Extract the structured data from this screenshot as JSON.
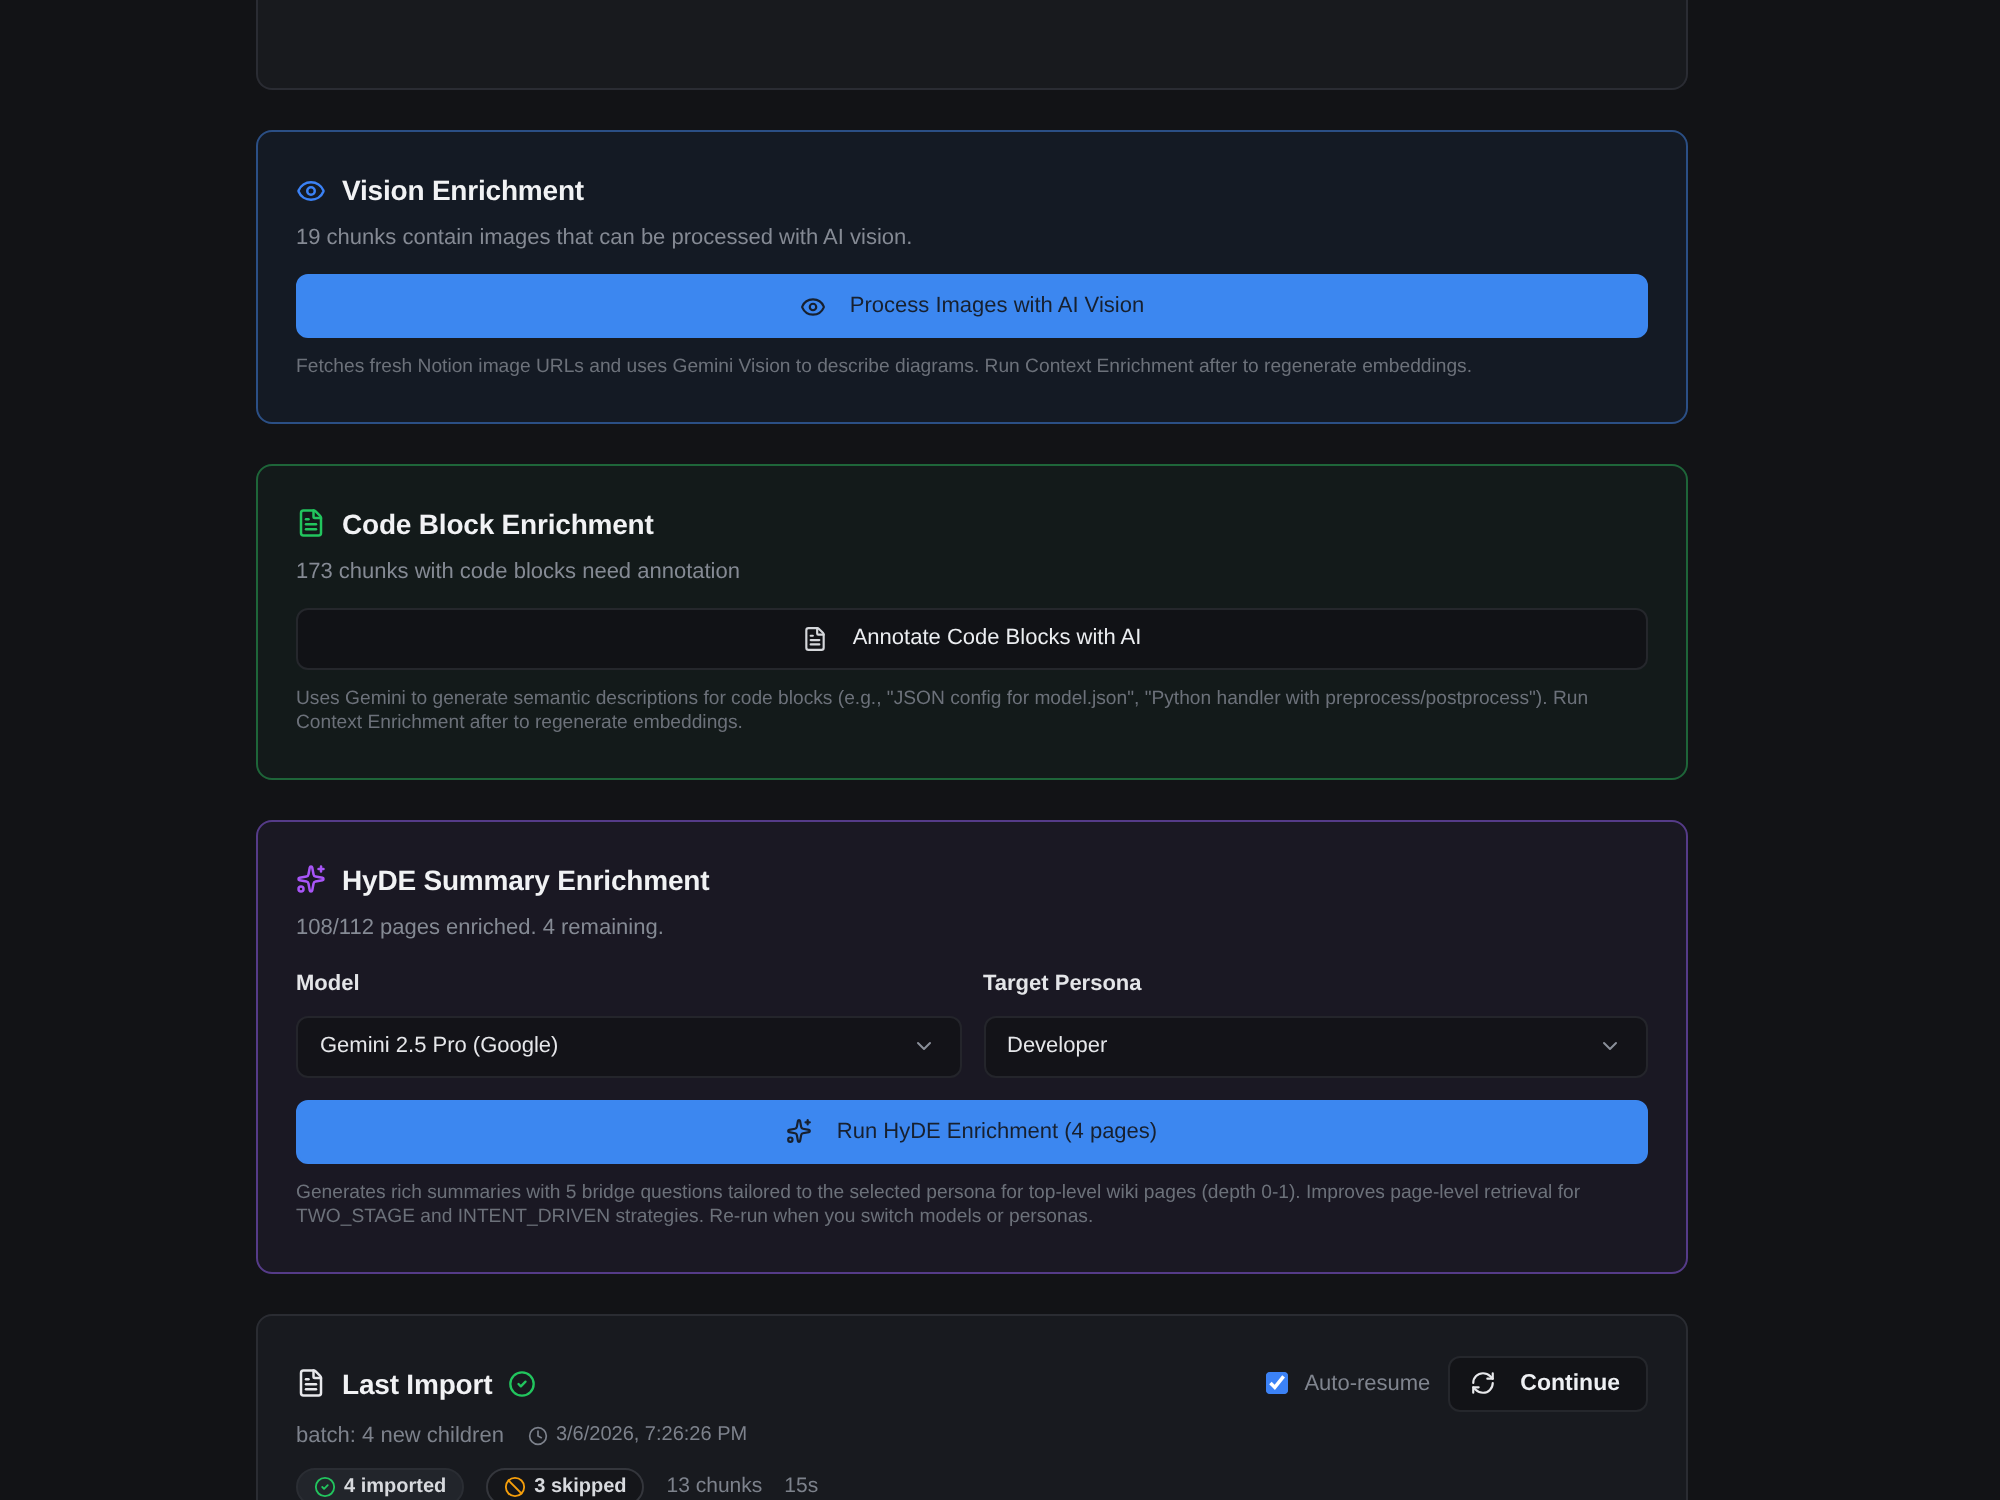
{
  "cards": [
    {
      "kind": "vision",
      "title": "Vision Enrichment",
      "description": "19 chunks contain images that can be processed with AI vision.",
      "button": "Process Images with AI Vision",
      "note": "Fetches fresh Notion image URLs and uses Gemini Vision to describe diagrams. Run Context Enrichment after to regenerate embeddings."
    },
    {
      "kind": "code",
      "title": "Code Block Enrichment",
      "description": "173 chunks with code blocks need annotation",
      "button": "Annotate Code Blocks with AI",
      "note": "Uses Gemini to generate semantic descriptions for code blocks (e.g., \"JSON config for model.json\", \"Python handler with preprocess/postprocess\"). Run Context Enrichment after to regenerate embeddings."
    },
    {
      "kind": "hyde",
      "title": "HyDE Summary Enrichment",
      "description": "108/112 pages enriched. 4 remaining.",
      "fields": [
        {
          "label": "Model",
          "value": "Gemini 2.5 Pro (Google)"
        },
        {
          "label": "Target Persona",
          "value": "Developer"
        }
      ],
      "button": "Run HyDE Enrichment (4 pages)",
      "note": "Generates rich summaries with 5 bridge questions tailored to the selected persona for top-level wiki pages (depth 0-1). Improves page-level retrieval for TWO_STAGE and INTENT_DRIVEN strategies. Re-run when you switch models or personas."
    }
  ],
  "last_import": {
    "title": "Last Import",
    "complete": true,
    "auto_resume": {
      "label": "Auto-resume",
      "checked": true
    },
    "continue_button": "Continue",
    "batch": "batch: 4 new children",
    "timestamp": "3/6/2026, 7:26:26 PM",
    "badges": [
      {
        "kind": "imported",
        "label": "4 imported"
      },
      {
        "kind": "skipped",
        "label": "3 skipped"
      }
    ],
    "stats": [
      "13 chunks",
      "15s"
    ]
  }
}
